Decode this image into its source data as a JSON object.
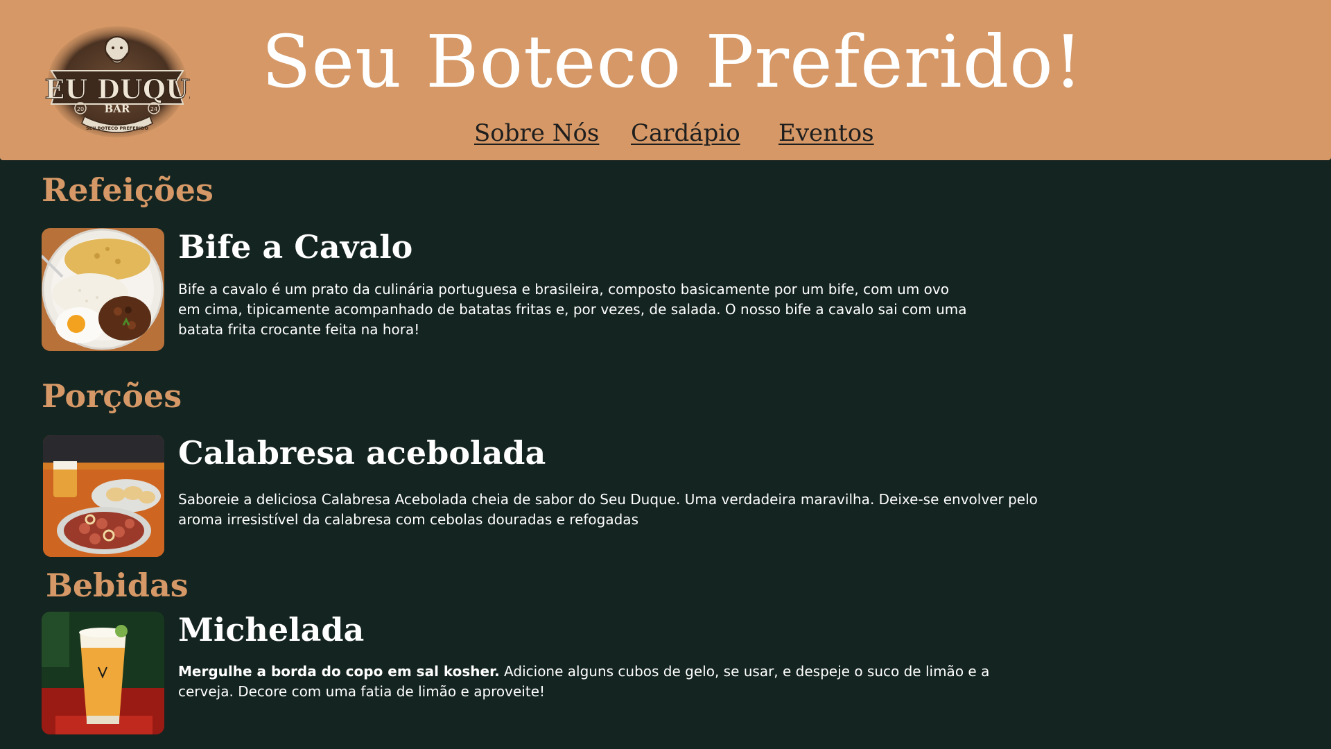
{
  "header": {
    "logo": {
      "text_main": "SEU DUQUE",
      "text_sub": "BAR",
      "year_left": "20",
      "year_right": "24",
      "ribbon": "SEU BOTECO PREFERIDO"
    },
    "title": "Seu Boteco Preferido!",
    "nav": [
      {
        "label": "Sobre Nós"
      },
      {
        "label": "Cardápio"
      },
      {
        "label": "Eventos"
      }
    ]
  },
  "menu": {
    "sections": [
      {
        "title": "Refeições",
        "items": [
          {
            "name": "Bife a Cavalo",
            "image": "bife-a-cavalo-photo",
            "description": "Bife a cavalo é um prato da culinária portuguesa e brasileira, composto basicamente por um bife, com um ovo em cima, tipicamente acompanhado de batatas fritas e, por vezes, de salada. O nosso bife a cavalo sai com uma batata frita crocante feita na hora!"
          }
        ]
      },
      {
        "title": "Porções",
        "items": [
          {
            "name": "Calabresa acebolada",
            "image": "calabresa-acebolada-photo",
            "description": "Saboreie a deliciosa Calabresa Acebolada cheia de sabor do Seu Duque. Uma verdadeira maravilha. Deixe-se envolver pelo aroma irresistível da calabresa com cebolas douradas e refogadas"
          }
        ]
      },
      {
        "title": "Bebidas",
        "items": [
          {
            "name": "Michelada",
            "image": "michelada-photo",
            "description_bold": "Mergulhe a borda do copo em sal kosher.",
            "description": " Adicione alguns cubos de gelo, se usar, e despeje o suco de limão e a cerveja. Decore com uma fatia de limão e aproveite!"
          }
        ]
      }
    ]
  },
  "colors": {
    "header_bg": "#d59866",
    "page_bg": "#142420",
    "accent": "#d59866",
    "text": "#ffffff"
  }
}
